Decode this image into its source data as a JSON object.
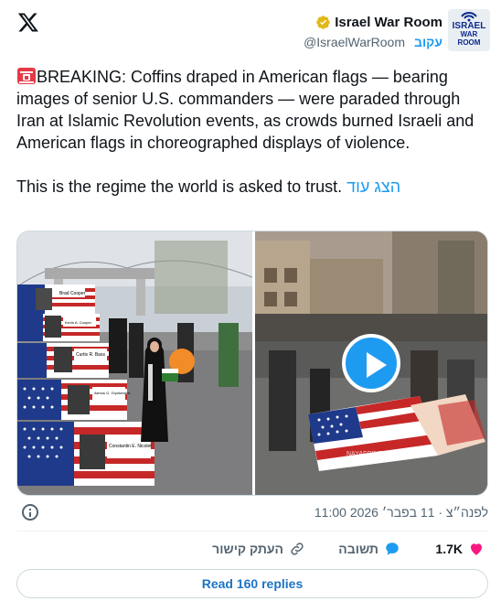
{
  "header": {
    "author_name": "Israel War Room",
    "handle": "@IsraelWarRoom",
    "follow_label": "עקוב",
    "avatar_text_1": "ISRAEL",
    "avatar_text_2": "WAR ROOM"
  },
  "tweet": {
    "text_line1": "BREAKING: Coffins draped in American flags — bearing images of senior U.S. commanders — were paraded through Iran at Islamic Revolution events, as crowds burned Israeli and American flags in choreographed displays of violence.",
    "text_line2": "This is the regime the world is asked to trust.",
    "show_more_label": "הצג עוד"
  },
  "media": {
    "left_image_labels": [
      "Brad Cooper",
      "Kevin A. Cooper",
      "Curtis R. Bass",
      "Alexus G. Grynkewich",
      "Constantin E. Nicolet"
    ],
    "right_watermark": "NAYAFORIRAQ"
  },
  "meta": {
    "timestamp": "11:00 לפנה״צ · 11 בפבר׳ 2026"
  },
  "actions": {
    "likes_count": "1.7K",
    "reply_label": "תשובה",
    "copy_link_label": "העתק קישור"
  },
  "read_replies_label": "Read 160 replies",
  "colors": {
    "accent": "#1d9bf0",
    "like": "#f91880",
    "text_secondary": "#536471"
  }
}
